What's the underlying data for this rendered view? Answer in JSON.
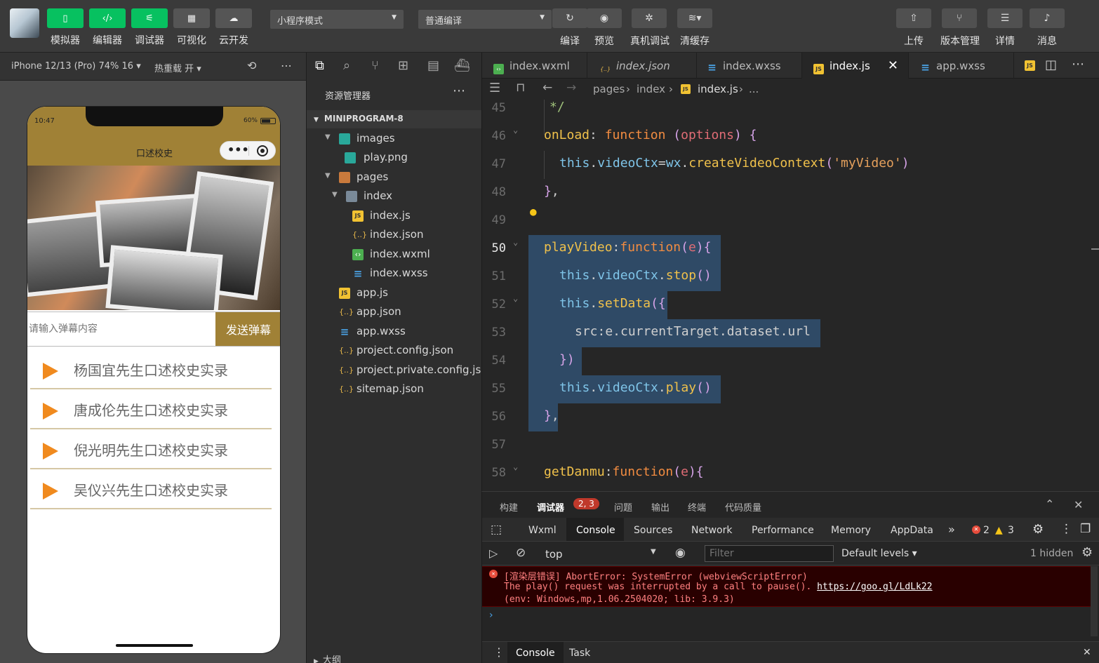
{
  "toolbar": {
    "modes": [
      "模拟器",
      "编辑器",
      "调试器",
      "可视化",
      "云开发"
    ],
    "mode_select": "小程序模式",
    "compile_select": "普通编译",
    "actions": [
      "编译",
      "预览",
      "真机调试",
      "清缓存"
    ],
    "right_actions": [
      "上传",
      "版本管理",
      "详情",
      "消息"
    ]
  },
  "simulator": {
    "device": "iPhone 12/13 (Pro) 74% 16",
    "hot_reload": "热重载 开",
    "status_time": "10:47",
    "battery": "60%",
    "nav_title": "口述校史",
    "danmu_placeholder": "请输入弹幕内容",
    "danmu_button": "发送弹幕",
    "videos": [
      "杨国宜先生口述校史实录",
      "唐成伦先生口述校史实录",
      "倪光明先生口述校史实录",
      "吴仪兴先生口述校史实录"
    ]
  },
  "explorer": {
    "title": "资源管理器",
    "root": "MINIPROGRAM-8",
    "items": [
      {
        "name": "images",
        "type": "folder"
      },
      {
        "name": "play.png",
        "type": "png"
      },
      {
        "name": "pages",
        "type": "folder"
      },
      {
        "name": "index",
        "type": "folder"
      },
      {
        "name": "index.js",
        "type": "js"
      },
      {
        "name": "index.json",
        "type": "json"
      },
      {
        "name": "index.wxml",
        "type": "wxml"
      },
      {
        "name": "index.wxss",
        "type": "wxss"
      },
      {
        "name": "app.js",
        "type": "js"
      },
      {
        "name": "app.json",
        "type": "json"
      },
      {
        "name": "app.wxss",
        "type": "wxss"
      },
      {
        "name": "project.config.json",
        "type": "json"
      },
      {
        "name": "project.private.config.js...",
        "type": "json"
      },
      {
        "name": "sitemap.json",
        "type": "json"
      }
    ],
    "outline": "大纲"
  },
  "editor": {
    "tabs": [
      "index.wxml",
      "index.json",
      "index.wxss",
      "index.js",
      "app.wxss"
    ],
    "breadcrumb": [
      "pages",
      "index",
      "index.js",
      "..."
    ],
    "line_numbers": [
      "45",
      "46",
      "47",
      "48",
      "49",
      "50",
      "51",
      "52",
      "53",
      "54",
      "55",
      "56",
      "57",
      "58"
    ]
  },
  "bottom": {
    "panel_tabs": [
      "构建",
      "调试器",
      "问题",
      "输出",
      "终端",
      "代码质量"
    ],
    "debugger_badge": "2, 3",
    "devtools_tabs": [
      "Wxml",
      "Console",
      "Sources",
      "Network",
      "Performance",
      "Memory",
      "AppData"
    ],
    "error_count": "2",
    "warning_count": "3",
    "context": "top",
    "filter_placeholder": "Filter",
    "levels": "Default levels",
    "hidden": "1 hidden",
    "error_line1": "[渲染层错误] AbortError: SystemError (webviewScriptError)",
    "error_line2_text": "The play() request was interrupted by a call to pause(). ",
    "error_link": "https://goo.gl/LdLk22",
    "error_line3": "(env: Windows,mp,1.06.2504020; lib: 3.9.3)",
    "drawer_tabs": [
      "Console",
      "Task"
    ]
  },
  "colors": {
    "accent": "#07c160",
    "brand": "#a08136",
    "error": "#ff8080"
  }
}
